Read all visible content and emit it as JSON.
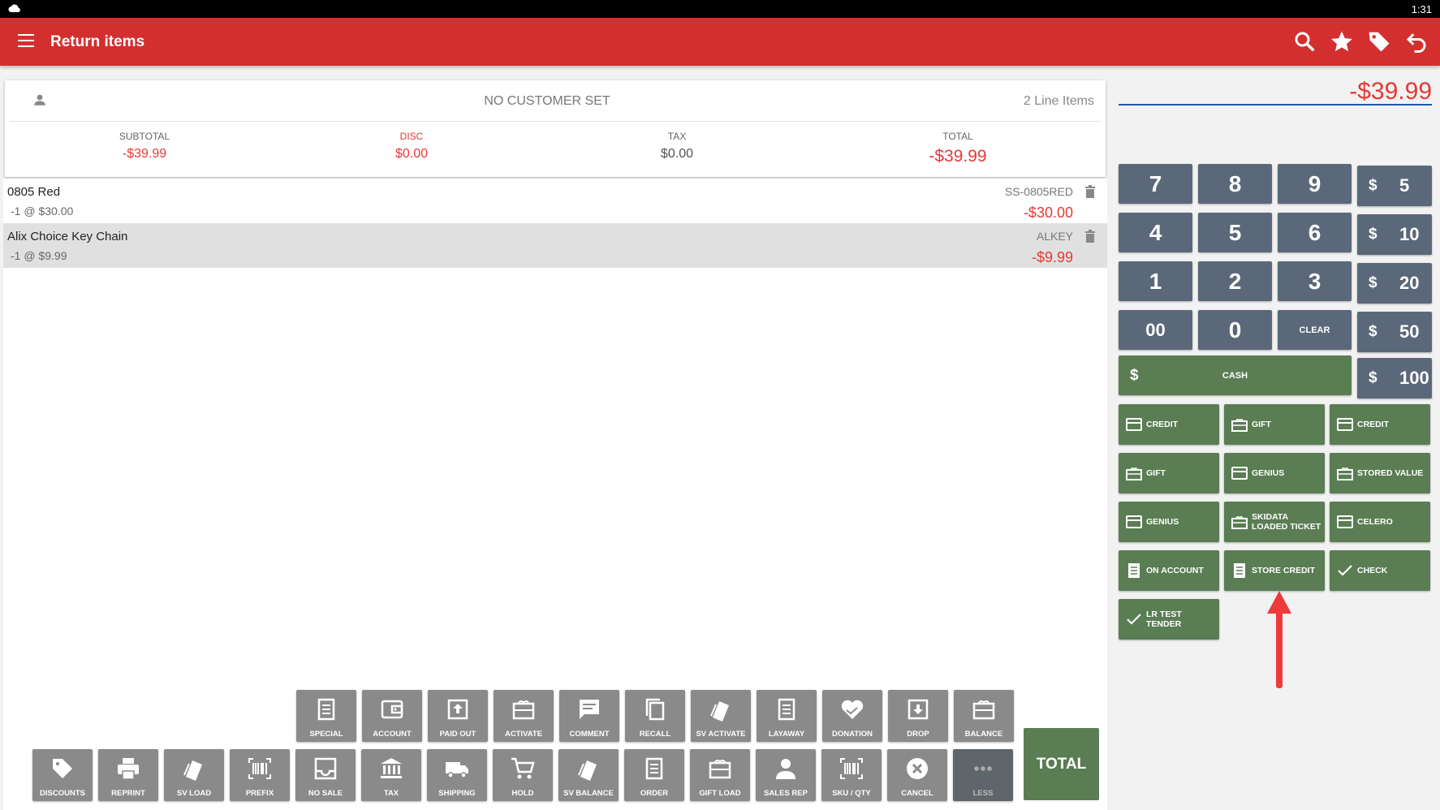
{
  "status": {
    "time": "1:31"
  },
  "appbar": {
    "title": "Return items"
  },
  "summary": {
    "customer": "NO CUSTOMER SET",
    "line_items": "2 Line Items",
    "subtotal_label": "SUBTOTAL",
    "subtotal": "-$39.99",
    "disc_label": "DISC",
    "disc": "$0.00",
    "tax_label": "TAX",
    "tax": "$0.00",
    "total_label": "TOTAL",
    "total": "-$39.99"
  },
  "items": [
    {
      "name": "0805 Red",
      "qty": "-1 @ $30.00",
      "sku": "SS-0805RED",
      "price": "-$30.00"
    },
    {
      "name": "Alix Choice Key Chain",
      "qty": "-1 @ $9.99",
      "sku": "ALKEY",
      "price": "-$9.99"
    }
  ],
  "func_row1": [
    "SPECIAL",
    "ACCOUNT",
    "PAID OUT",
    "ACTIVATE",
    "COMMENT",
    "RECALL",
    "SV ACTIVATE",
    "LAYAWAY",
    "DONATION",
    "DROP",
    "BALANCE"
  ],
  "func_row2": [
    "DISCOUNTS",
    "REPRINT",
    "SV LOAD",
    "PREFIX",
    "NO SALE",
    "TAX",
    "SHIPPING",
    "HOLD",
    "SV BALANCE",
    "ORDER",
    "GIFT LOAD",
    "SALES REP",
    "SKU / QTY",
    "CANCEL",
    "LESS"
  ],
  "total_button": "TOTAL",
  "amount": "-$39.99",
  "keypad": {
    "digits": [
      "7",
      "8",
      "9",
      "4",
      "5",
      "6",
      "1",
      "2",
      "3",
      "00",
      "0"
    ],
    "clear": "CLEAR",
    "cash": "CASH",
    "dollar": "$",
    "denoms": [
      "5",
      "10",
      "20",
      "50",
      "100"
    ]
  },
  "tenders": [
    "CREDIT",
    "GIFT",
    "CREDIT",
    "GIFT",
    "GENIUS",
    "STORED VALUE",
    "GENIUS",
    "SKIDATA LOADED TICKET",
    "CELERO",
    "ON ACCOUNT",
    "STORE CREDIT",
    "CHECK",
    "LR TEST TENDER"
  ],
  "colors": {
    "appbar": "#d32f2f",
    "keypad": "#5a6879",
    "tender": "#5a7d53",
    "negative": "#e53935",
    "arrow": "#ee3a3a"
  }
}
